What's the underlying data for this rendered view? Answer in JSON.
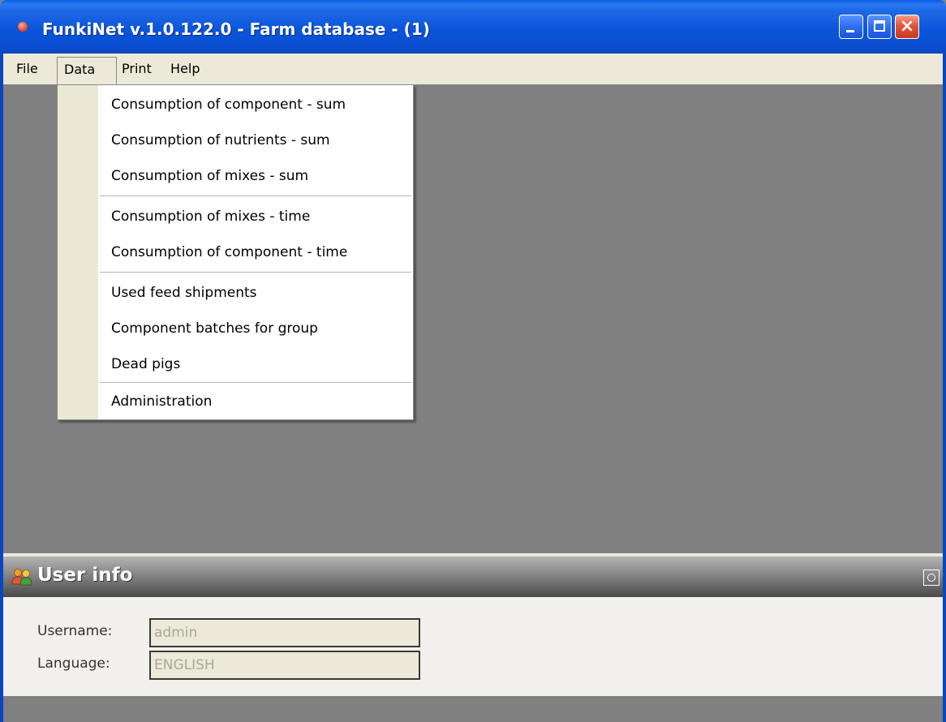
{
  "window": {
    "title": "FunkiNet v.1.0.122.0 - Farm database - (1)",
    "controls": {
      "minimize": "minimize",
      "maximize": "maximize",
      "close": "×"
    }
  },
  "menubar": {
    "items": [
      {
        "label": "File"
      },
      {
        "label": "Data"
      },
      {
        "label": "Print"
      },
      {
        "label": "Help"
      }
    ]
  },
  "data_menu": {
    "items": [
      {
        "label": "Consumption of component - sum"
      },
      {
        "label": "Consumption of nutrients - sum"
      },
      {
        "label": "Consumption of mixes - sum"
      },
      {
        "label": "Consumption of mixes - time"
      },
      {
        "label": "Consumption of component - time"
      },
      {
        "label": "Used feed shipments"
      },
      {
        "label": "Component batches for group"
      },
      {
        "label": "Dead pigs"
      },
      {
        "label": "Administration"
      }
    ]
  },
  "user_info": {
    "title": "User info",
    "icon": "users-icon",
    "username_label": "Username:",
    "username_value": "admin",
    "language_label": "Language:",
    "language_value": "ENGLISH"
  },
  "colors": {
    "titlebar": "#0a55da",
    "menubar": "#ece9d8",
    "workspace": "#808080",
    "close_button": "#e2553a"
  }
}
